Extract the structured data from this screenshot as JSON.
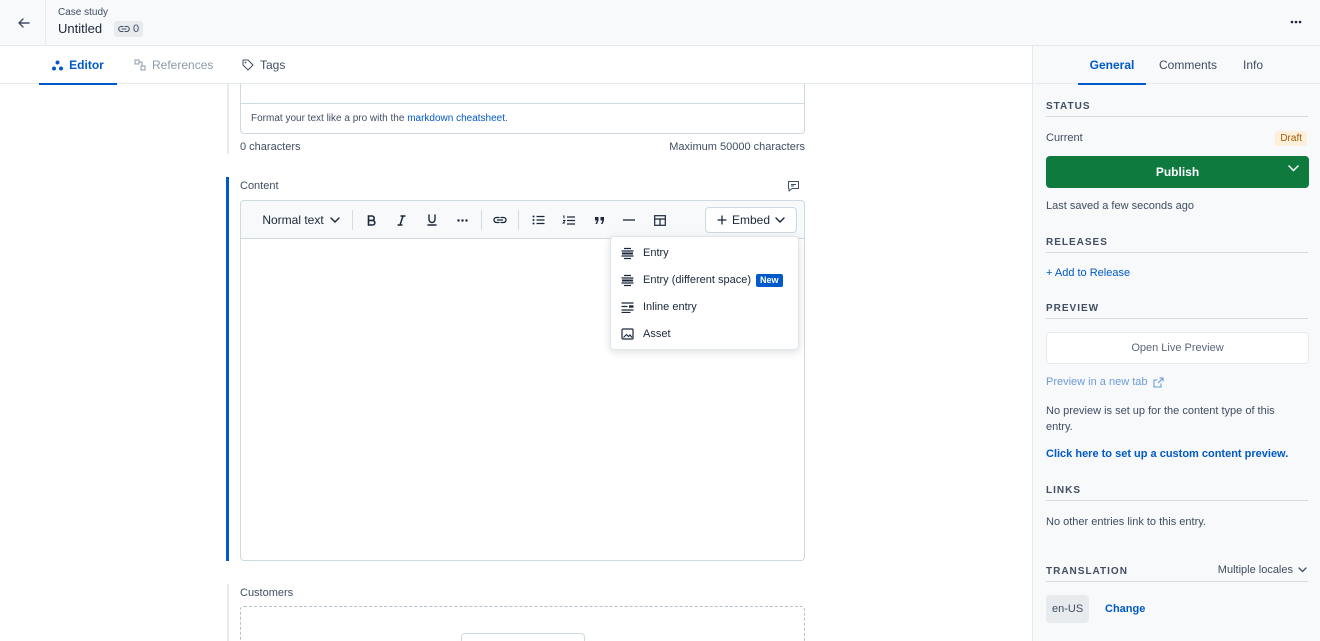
{
  "header": {
    "content_type": "Case study",
    "title": "Untitled",
    "references_count": "0"
  },
  "tabs": [
    {
      "label": "Editor"
    },
    {
      "label": "References"
    },
    {
      "label": "Tags"
    }
  ],
  "editor": {
    "hint_prefix": "Format your text like a pro with the",
    "hint_link": "markdown cheatsheet",
    "hint_suffix": ".",
    "char_count": "0 characters",
    "char_max": "Maximum 50000 characters",
    "content_label": "Content",
    "format_select": "Normal text",
    "embed_label": "Embed",
    "embed_menu": [
      {
        "label": "Entry"
      },
      {
        "label": "Entry (different space)",
        "badge": "New"
      },
      {
        "label": "Inline entry"
      },
      {
        "label": "Asset"
      }
    ],
    "customers_label": "Customers"
  },
  "sidebar": {
    "tabs": [
      {
        "label": "General"
      },
      {
        "label": "Comments"
      },
      {
        "label": "Info"
      }
    ],
    "status": {
      "heading": "STATUS",
      "current_label": "Current",
      "badge": "Draft",
      "publish_label": "Publish",
      "last_saved": "Last saved a few seconds ago"
    },
    "releases": {
      "heading": "RELEASES",
      "add_label": "+ Add to Release"
    },
    "preview": {
      "heading": "PREVIEW",
      "open_live": "Open Live Preview",
      "new_tab": "Preview in a new tab",
      "no_preview": "No preview is set up for the content type of this entry.",
      "setup_link": "Click here to set up a custom content preview."
    },
    "links": {
      "heading": "LINKS",
      "text": "No other entries link to this entry."
    },
    "translation": {
      "heading": "TRANSLATION",
      "mode": "Multiple locales",
      "locale": "en-US",
      "change_label": "Change"
    }
  },
  "colors": {
    "accent": "#0059c8",
    "publish": "#0e7a3e",
    "draft_bg": "#fdf0da",
    "draft_text": "#a15c05"
  }
}
